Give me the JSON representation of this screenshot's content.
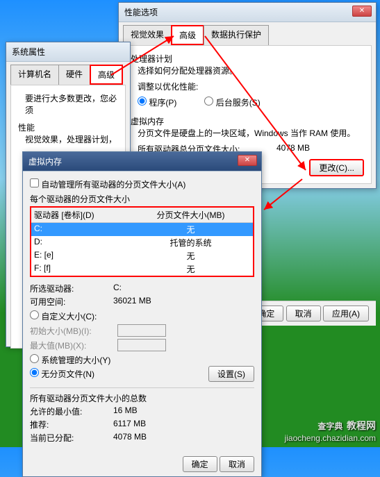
{
  "sysprops": {
    "title": "系统属性",
    "tabs": {
      "computer": "计算机名",
      "hardware": "硬件",
      "advanced": "高级"
    },
    "note": "要进行大多数更改，您必须",
    "perf": {
      "title": "性能",
      "desc": "视觉效果，处理器计划，"
    }
  },
  "perfopts": {
    "title": "性能选项",
    "tabs": {
      "visual": "视觉效果",
      "advanced": "高级",
      "dep": "数据执行保护"
    },
    "cpu": {
      "title": "处理器计划",
      "desc": "选择如何分配处理器资源。",
      "adjust": "调整以优化性能:",
      "programs": "程序(P)",
      "bgservices": "后台服务(S)"
    },
    "vm": {
      "title": "虚拟内存",
      "desc": "分页文件是硬盘上的一块区域，Windows 当作 RAM 使用。",
      "totalLabel": "所有驱动器总分页文件大小:",
      "totalValue": "4078 MB",
      "change": "更改(C)..."
    },
    "ok": "确定",
    "cancel": "取消",
    "apply": "应用(A)"
  },
  "vmdlg": {
    "title": "虚拟内存",
    "auto": "自动管理所有驱动器的分页文件大小(A)",
    "perdrive": "每个驱动器的分页文件大小",
    "colDrive": "驱动器 [卷标](D)",
    "colSize": "分页文件大小(MB)",
    "drives": [
      {
        "d": "C:",
        "s": "无"
      },
      {
        "d": "D:",
        "s": "托管的系统"
      },
      {
        "d": "E:    [e]",
        "s": "无"
      },
      {
        "d": "F:    [f]",
        "s": "无"
      }
    ],
    "selDrive": "所选驱动器:",
    "selDriveVal": "C:",
    "freeSpace": "可用空间:",
    "freeSpaceVal": "36021 MB",
    "custom": "自定义大小(C):",
    "initLabel": "初始大小(MB)(I):",
    "maxLabel": "最大值(MB)(X):",
    "sysManaged": "系统管理的大小(Y)",
    "noPage": "无分页文件(N)",
    "set": "设置(S)",
    "totalsTitle": "所有驱动器分页文件大小的总数",
    "minAllow": "允许的最小值:",
    "minAllowVal": "16 MB",
    "recommend": "推荐:",
    "recommendVal": "6117 MB",
    "current": "当前已分配:",
    "currentVal": "4078 MB",
    "ok": "确定",
    "cancel": "取消"
  },
  "watermark": {
    "big": "查字典",
    "url": "jiaocheng.chazidian.com",
    "sub": "教程网"
  }
}
